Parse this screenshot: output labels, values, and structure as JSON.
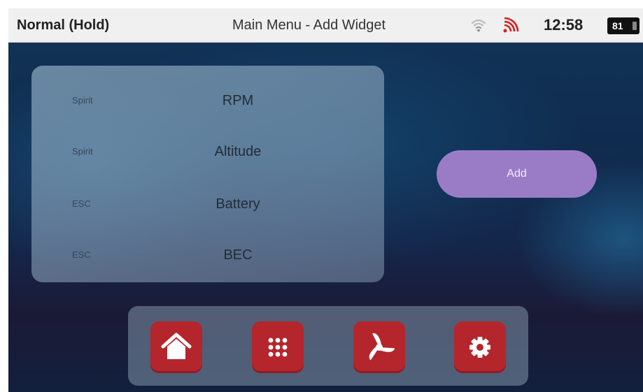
{
  "status_bar": {
    "mode": "Normal (Hold)",
    "title": "Main Menu - Add Widget",
    "time": "12:58",
    "battery": "81",
    "icons": [
      "wifi-icon",
      "signal-icon"
    ]
  },
  "widget_list": [
    {
      "source": "Spirit",
      "name": "RPM"
    },
    {
      "source": "Spirit",
      "name": "Altitude"
    },
    {
      "source": "ESC",
      "name": "Battery"
    },
    {
      "source": "ESC",
      "name": "BEC"
    }
  ],
  "add_button": {
    "label": "Add",
    "color": "#9a7cc6"
  },
  "dock": {
    "accent": "#b5252c",
    "items": [
      "home-icon",
      "apps-grid-icon",
      "propeller-icon",
      "settings-gear-icon"
    ]
  }
}
